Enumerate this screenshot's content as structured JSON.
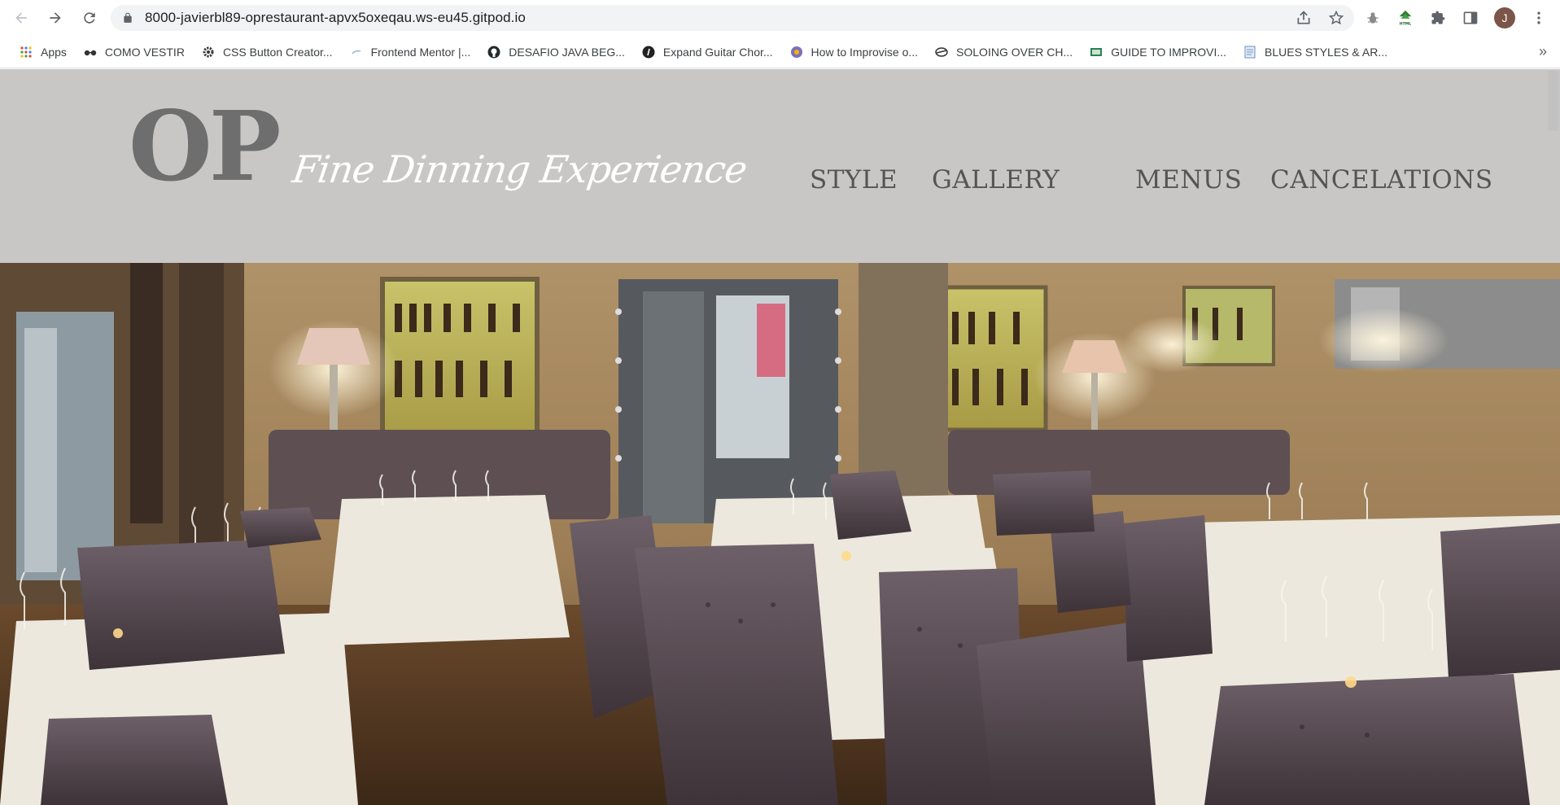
{
  "browser": {
    "url": "8000-javierbl89-oprestaurant-apvx5oxeqau.ws-eu45.gitpod.io",
    "profile_initial": "J",
    "icons": {
      "back": "arrow-left-icon",
      "forward": "arrow-right-icon",
      "reload": "reload-icon",
      "lock": "lock-icon",
      "share": "share-icon",
      "star": "star-icon",
      "bug": "bug-extension-icon",
      "html": "html-extension-icon",
      "puzzle": "extensions-puzzle-icon",
      "sidepanel": "side-panel-icon",
      "menu": "more-vert-icon"
    },
    "accent": "#1a73e8"
  },
  "bookmarks": {
    "items": [
      {
        "label": "Apps",
        "icon": "apps-grid-icon"
      },
      {
        "label": "COMO VESTIR",
        "icon": "glasses-icon"
      },
      {
        "label": "CSS Button Creator...",
        "icon": "gear-icon"
      },
      {
        "label": "Frontend Mentor |...",
        "icon": "frontend-mentor-icon"
      },
      {
        "label": "DESAFIO JAVA BEG...",
        "icon": "github-icon"
      },
      {
        "label": "Expand Guitar Chor...",
        "icon": "guitar-site-icon"
      },
      {
        "label": "How to Improvise o...",
        "icon": "site-icon"
      },
      {
        "label": "SOLOING OVER CH...",
        "icon": "site-icon"
      },
      {
        "label": "GUIDE TO IMPROVI...",
        "icon": "site-icon"
      },
      {
        "label": "BLUES STYLES & AR...",
        "icon": "document-icon"
      }
    ],
    "overflow": "»"
  },
  "site": {
    "logo": "OP",
    "tagline": "Fine Dinning Experience",
    "nav": {
      "style": "STYLE",
      "gallery": "GALLERY",
      "menus": "MENUS",
      "cancelations": "CANCELATIONS"
    },
    "header_bg": "#c9c7c6",
    "logo_color": "#6e6e6e",
    "nav_color": "#555555",
    "hero_image": "restaurant-dining-room-photo"
  }
}
